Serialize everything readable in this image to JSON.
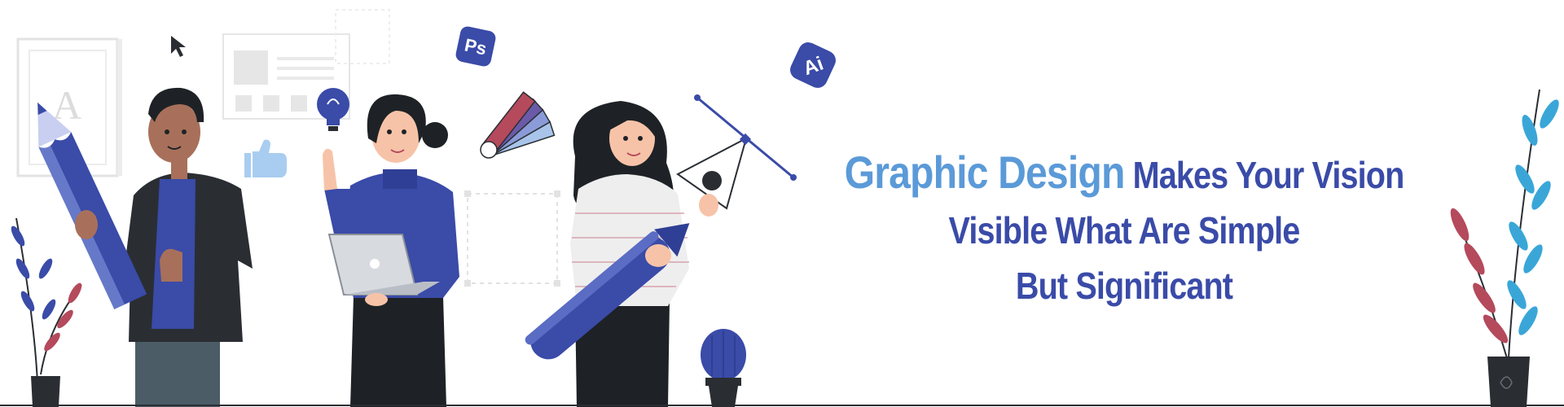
{
  "headline": {
    "accent": "Graphic Design",
    "line1_rest": "Makes Your Vision",
    "line2": "Visible What Are Simple",
    "line3": "But Significant"
  },
  "app_icons": {
    "photoshop": "Ps",
    "illustrator": "Ai"
  },
  "frame_letter": "A",
  "colors": {
    "primary_blue": "#3a4ba8",
    "accent_blue": "#5b9ad8",
    "light_blue": "#a9c4ea",
    "dark_clothing": "#2a2e33",
    "skin_dark": "#a8705a",
    "skin_light": "#f7c3a8",
    "plant_red": "#b44a5c",
    "plant_blue": "#3aa6d8"
  },
  "icons": [
    "cursor-icon",
    "lightbulb-icon",
    "thumbs-up-icon",
    "color-swatch-icon",
    "pen-tool-icon",
    "pencil-icon",
    "laptop-icon",
    "cactus-icon",
    "plant-icon",
    "image-frame-icon",
    "layout-wireframe-icon"
  ]
}
